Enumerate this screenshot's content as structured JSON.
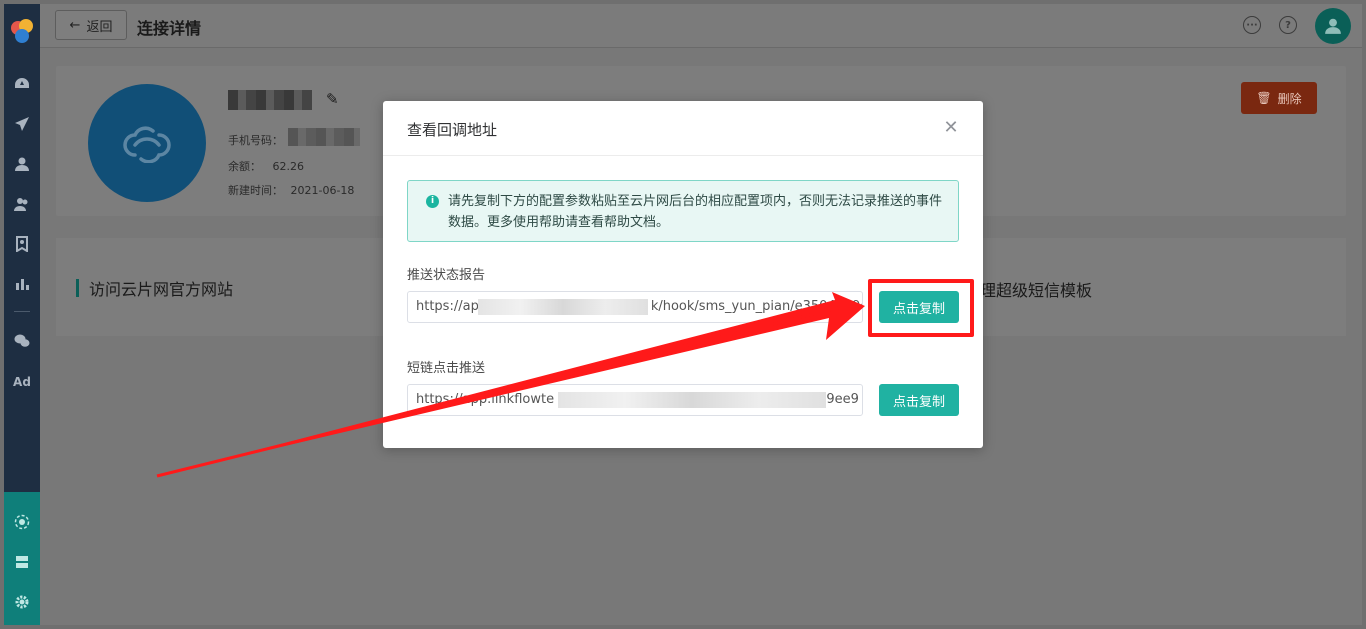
{
  "header": {
    "back_label": "返回",
    "title": "连接详情"
  },
  "profile": {
    "phone_label": "手机号码：",
    "balance_label": "余额：",
    "balance_value": "62.26",
    "created_label": "新建时间：",
    "created_value": "2021-06-18",
    "delete_label": "删除"
  },
  "links": {
    "left_label": "访问云片网官方网站",
    "right_label": "理超级短信模板"
  },
  "modal": {
    "title": "查看回调地址",
    "alert_text": "请先复制下方的配置参数粘贴至云片网后台的相应配置项内，否则无法记录推送的事件数据。更多使用帮助请查看帮助文档。",
    "report_label": "推送状态报告",
    "report_url_visible_start": "https://ap",
    "report_url_visible_end": "k/hook/sms_yun_pian/e3504a39ee9",
    "copy_label_1": "点击复制",
    "shortlink_label": "短链点击推送",
    "shortlink_url_visible_start": "https://app.linkflowte",
    "shortlink_url_visible_end": "29ee9",
    "copy_label_2": "点击复制"
  },
  "sidebar": {
    "ad_label": "Ad"
  },
  "colors": {
    "accent": "#20b2a2",
    "sidebar": "#1e2e42",
    "annotation_red": "#ff1a1a",
    "delete_red": "#c0391b"
  }
}
